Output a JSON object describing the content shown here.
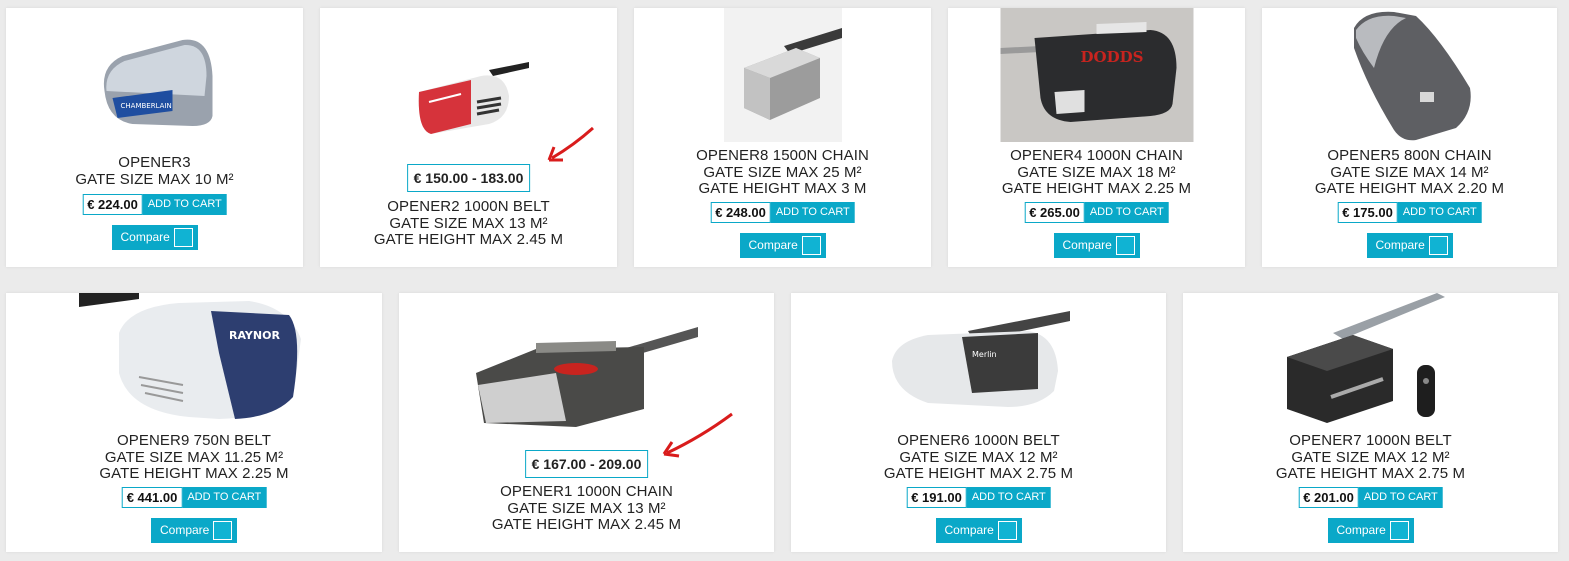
{
  "labels": {
    "add_to_cart": "ADD TO CART",
    "compare": "Compare"
  },
  "products": [
    {
      "name": "OPENER3",
      "line2": "GATE SIZE MAX 10 M²",
      "line3": "",
      "price": "€ 224.00",
      "icon": "garage-opener-blue-icon"
    },
    {
      "name": "OPENER2 1000N BELT",
      "line2": "GATE SIZE MAX 13 M²",
      "line3": "GATE HEIGHT MAX 2.45 M",
      "price_range": "€ 150.00 - 183.00",
      "icon": "garage-opener-red-icon"
    },
    {
      "name": "OPENER8 1500N CHAIN",
      "line2": "GATE SIZE MAX 25 M²",
      "line3": "GATE HEIGHT MAX 3 M",
      "price": "€ 248.00",
      "icon": "garage-opener-grey-icon"
    },
    {
      "name": "OPENER4 1000N CHAIN",
      "line2": "GATE SIZE MAX 18 M²",
      "line3": "GATE HEIGHT MAX 2.25 M",
      "price": "€ 265.00",
      "icon": "garage-opener-dodds-icon"
    },
    {
      "name": "OPENER5 800N CHAIN",
      "line2": "GATE SIZE MAX 14 M²",
      "line3": "GATE HEIGHT MAX 2.20 M",
      "price": "€ 175.00",
      "icon": "garage-opener-dark-grey-icon"
    },
    {
      "name": "OPENER9 750N BELT",
      "line2": "GATE SIZE MAX 11.25 M²",
      "line3": "GATE HEIGHT MAX 2.25 M",
      "price": "€ 441.00",
      "icon": "garage-opener-raynor-icon"
    },
    {
      "name": "OPENER1 1000N CHAIN",
      "line2": "GATE SIZE MAX 13 M²",
      "line3": "GATE HEIGHT MAX 2.45 M",
      "price_range": "€ 167.00 - 209.00",
      "icon": "garage-opener-chamberlain-icon"
    },
    {
      "name": "OPENER6 1000N BELT",
      "line2": "GATE SIZE MAX 12 M²",
      "line3": "GATE HEIGHT MAX 2.75 M",
      "price": "€ 191.00",
      "icon": "garage-opener-merlin-icon"
    },
    {
      "name": "OPENER7 1000N BELT",
      "line2": "GATE SIZE MAX 12 M²",
      "line3": "GATE HEIGHT MAX 2.75 M",
      "price": "€ 201.00",
      "icon": "garage-opener-black-icon"
    }
  ],
  "colors": {
    "accent": "#0aa8c8",
    "arrow": "#d91c1c"
  }
}
